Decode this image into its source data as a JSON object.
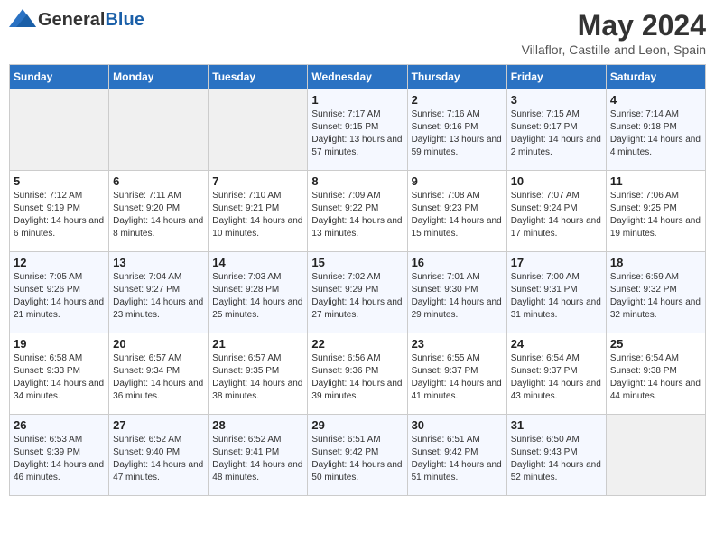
{
  "header": {
    "logo_general": "General",
    "logo_blue": "Blue",
    "title": "May 2024",
    "subtitle": "Villaflor, Castille and Leon, Spain"
  },
  "days_of_week": [
    "Sunday",
    "Monday",
    "Tuesday",
    "Wednesday",
    "Thursday",
    "Friday",
    "Saturday"
  ],
  "weeks": [
    [
      {
        "num": "",
        "info": ""
      },
      {
        "num": "",
        "info": ""
      },
      {
        "num": "",
        "info": ""
      },
      {
        "num": "1",
        "info": "Sunrise: 7:17 AM\nSunset: 9:15 PM\nDaylight: 13 hours and 57 minutes."
      },
      {
        "num": "2",
        "info": "Sunrise: 7:16 AM\nSunset: 9:16 PM\nDaylight: 13 hours and 59 minutes."
      },
      {
        "num": "3",
        "info": "Sunrise: 7:15 AM\nSunset: 9:17 PM\nDaylight: 14 hours and 2 minutes."
      },
      {
        "num": "4",
        "info": "Sunrise: 7:14 AM\nSunset: 9:18 PM\nDaylight: 14 hours and 4 minutes."
      }
    ],
    [
      {
        "num": "5",
        "info": "Sunrise: 7:12 AM\nSunset: 9:19 PM\nDaylight: 14 hours and 6 minutes."
      },
      {
        "num": "6",
        "info": "Sunrise: 7:11 AM\nSunset: 9:20 PM\nDaylight: 14 hours and 8 minutes."
      },
      {
        "num": "7",
        "info": "Sunrise: 7:10 AM\nSunset: 9:21 PM\nDaylight: 14 hours and 10 minutes."
      },
      {
        "num": "8",
        "info": "Sunrise: 7:09 AM\nSunset: 9:22 PM\nDaylight: 14 hours and 13 minutes."
      },
      {
        "num": "9",
        "info": "Sunrise: 7:08 AM\nSunset: 9:23 PM\nDaylight: 14 hours and 15 minutes."
      },
      {
        "num": "10",
        "info": "Sunrise: 7:07 AM\nSunset: 9:24 PM\nDaylight: 14 hours and 17 minutes."
      },
      {
        "num": "11",
        "info": "Sunrise: 7:06 AM\nSunset: 9:25 PM\nDaylight: 14 hours and 19 minutes."
      }
    ],
    [
      {
        "num": "12",
        "info": "Sunrise: 7:05 AM\nSunset: 9:26 PM\nDaylight: 14 hours and 21 minutes."
      },
      {
        "num": "13",
        "info": "Sunrise: 7:04 AM\nSunset: 9:27 PM\nDaylight: 14 hours and 23 minutes."
      },
      {
        "num": "14",
        "info": "Sunrise: 7:03 AM\nSunset: 9:28 PM\nDaylight: 14 hours and 25 minutes."
      },
      {
        "num": "15",
        "info": "Sunrise: 7:02 AM\nSunset: 9:29 PM\nDaylight: 14 hours and 27 minutes."
      },
      {
        "num": "16",
        "info": "Sunrise: 7:01 AM\nSunset: 9:30 PM\nDaylight: 14 hours and 29 minutes."
      },
      {
        "num": "17",
        "info": "Sunrise: 7:00 AM\nSunset: 9:31 PM\nDaylight: 14 hours and 31 minutes."
      },
      {
        "num": "18",
        "info": "Sunrise: 6:59 AM\nSunset: 9:32 PM\nDaylight: 14 hours and 32 minutes."
      }
    ],
    [
      {
        "num": "19",
        "info": "Sunrise: 6:58 AM\nSunset: 9:33 PM\nDaylight: 14 hours and 34 minutes."
      },
      {
        "num": "20",
        "info": "Sunrise: 6:57 AM\nSunset: 9:34 PM\nDaylight: 14 hours and 36 minutes."
      },
      {
        "num": "21",
        "info": "Sunrise: 6:57 AM\nSunset: 9:35 PM\nDaylight: 14 hours and 38 minutes."
      },
      {
        "num": "22",
        "info": "Sunrise: 6:56 AM\nSunset: 9:36 PM\nDaylight: 14 hours and 39 minutes."
      },
      {
        "num": "23",
        "info": "Sunrise: 6:55 AM\nSunset: 9:37 PM\nDaylight: 14 hours and 41 minutes."
      },
      {
        "num": "24",
        "info": "Sunrise: 6:54 AM\nSunset: 9:37 PM\nDaylight: 14 hours and 43 minutes."
      },
      {
        "num": "25",
        "info": "Sunrise: 6:54 AM\nSunset: 9:38 PM\nDaylight: 14 hours and 44 minutes."
      }
    ],
    [
      {
        "num": "26",
        "info": "Sunrise: 6:53 AM\nSunset: 9:39 PM\nDaylight: 14 hours and 46 minutes."
      },
      {
        "num": "27",
        "info": "Sunrise: 6:52 AM\nSunset: 9:40 PM\nDaylight: 14 hours and 47 minutes."
      },
      {
        "num": "28",
        "info": "Sunrise: 6:52 AM\nSunset: 9:41 PM\nDaylight: 14 hours and 48 minutes."
      },
      {
        "num": "29",
        "info": "Sunrise: 6:51 AM\nSunset: 9:42 PM\nDaylight: 14 hours and 50 minutes."
      },
      {
        "num": "30",
        "info": "Sunrise: 6:51 AM\nSunset: 9:42 PM\nDaylight: 14 hours and 51 minutes."
      },
      {
        "num": "31",
        "info": "Sunrise: 6:50 AM\nSunset: 9:43 PM\nDaylight: 14 hours and 52 minutes."
      },
      {
        "num": "",
        "info": ""
      }
    ]
  ]
}
